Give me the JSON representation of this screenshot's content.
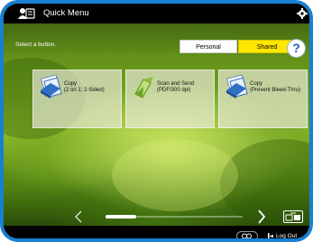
{
  "header": {
    "title": "Quick Menu",
    "title_icon": "quick-menu-icon",
    "settings_icon": "gear-icon"
  },
  "instruction": "Select a button.",
  "tabs": [
    {
      "label": "Personal",
      "selected": false
    },
    {
      "label": "Shared",
      "selected": true
    }
  ],
  "help_label": "?",
  "buttons": [
    {
      "line1": "Copy",
      "line2": "(2 on 1; 2-Sided)",
      "icon": "copy-icon"
    },
    {
      "line1": "Scan and Send",
      "line2": "(PDF/300 dpi)",
      "icon": "scan-send-icon"
    },
    {
      "line1": "Copy",
      "line2": "(Prevent Bleed-Thru)",
      "icon": "copy-icon"
    }
  ],
  "pagination": {
    "prev_icon": "chevron-left-icon",
    "next_icon": "chevron-right-icon"
  },
  "footer": {
    "logout_label": "Log Out"
  },
  "colors": {
    "frame": "#1a7fd0",
    "shared_tab": "#ffe600",
    "title_bar": "#000000"
  }
}
